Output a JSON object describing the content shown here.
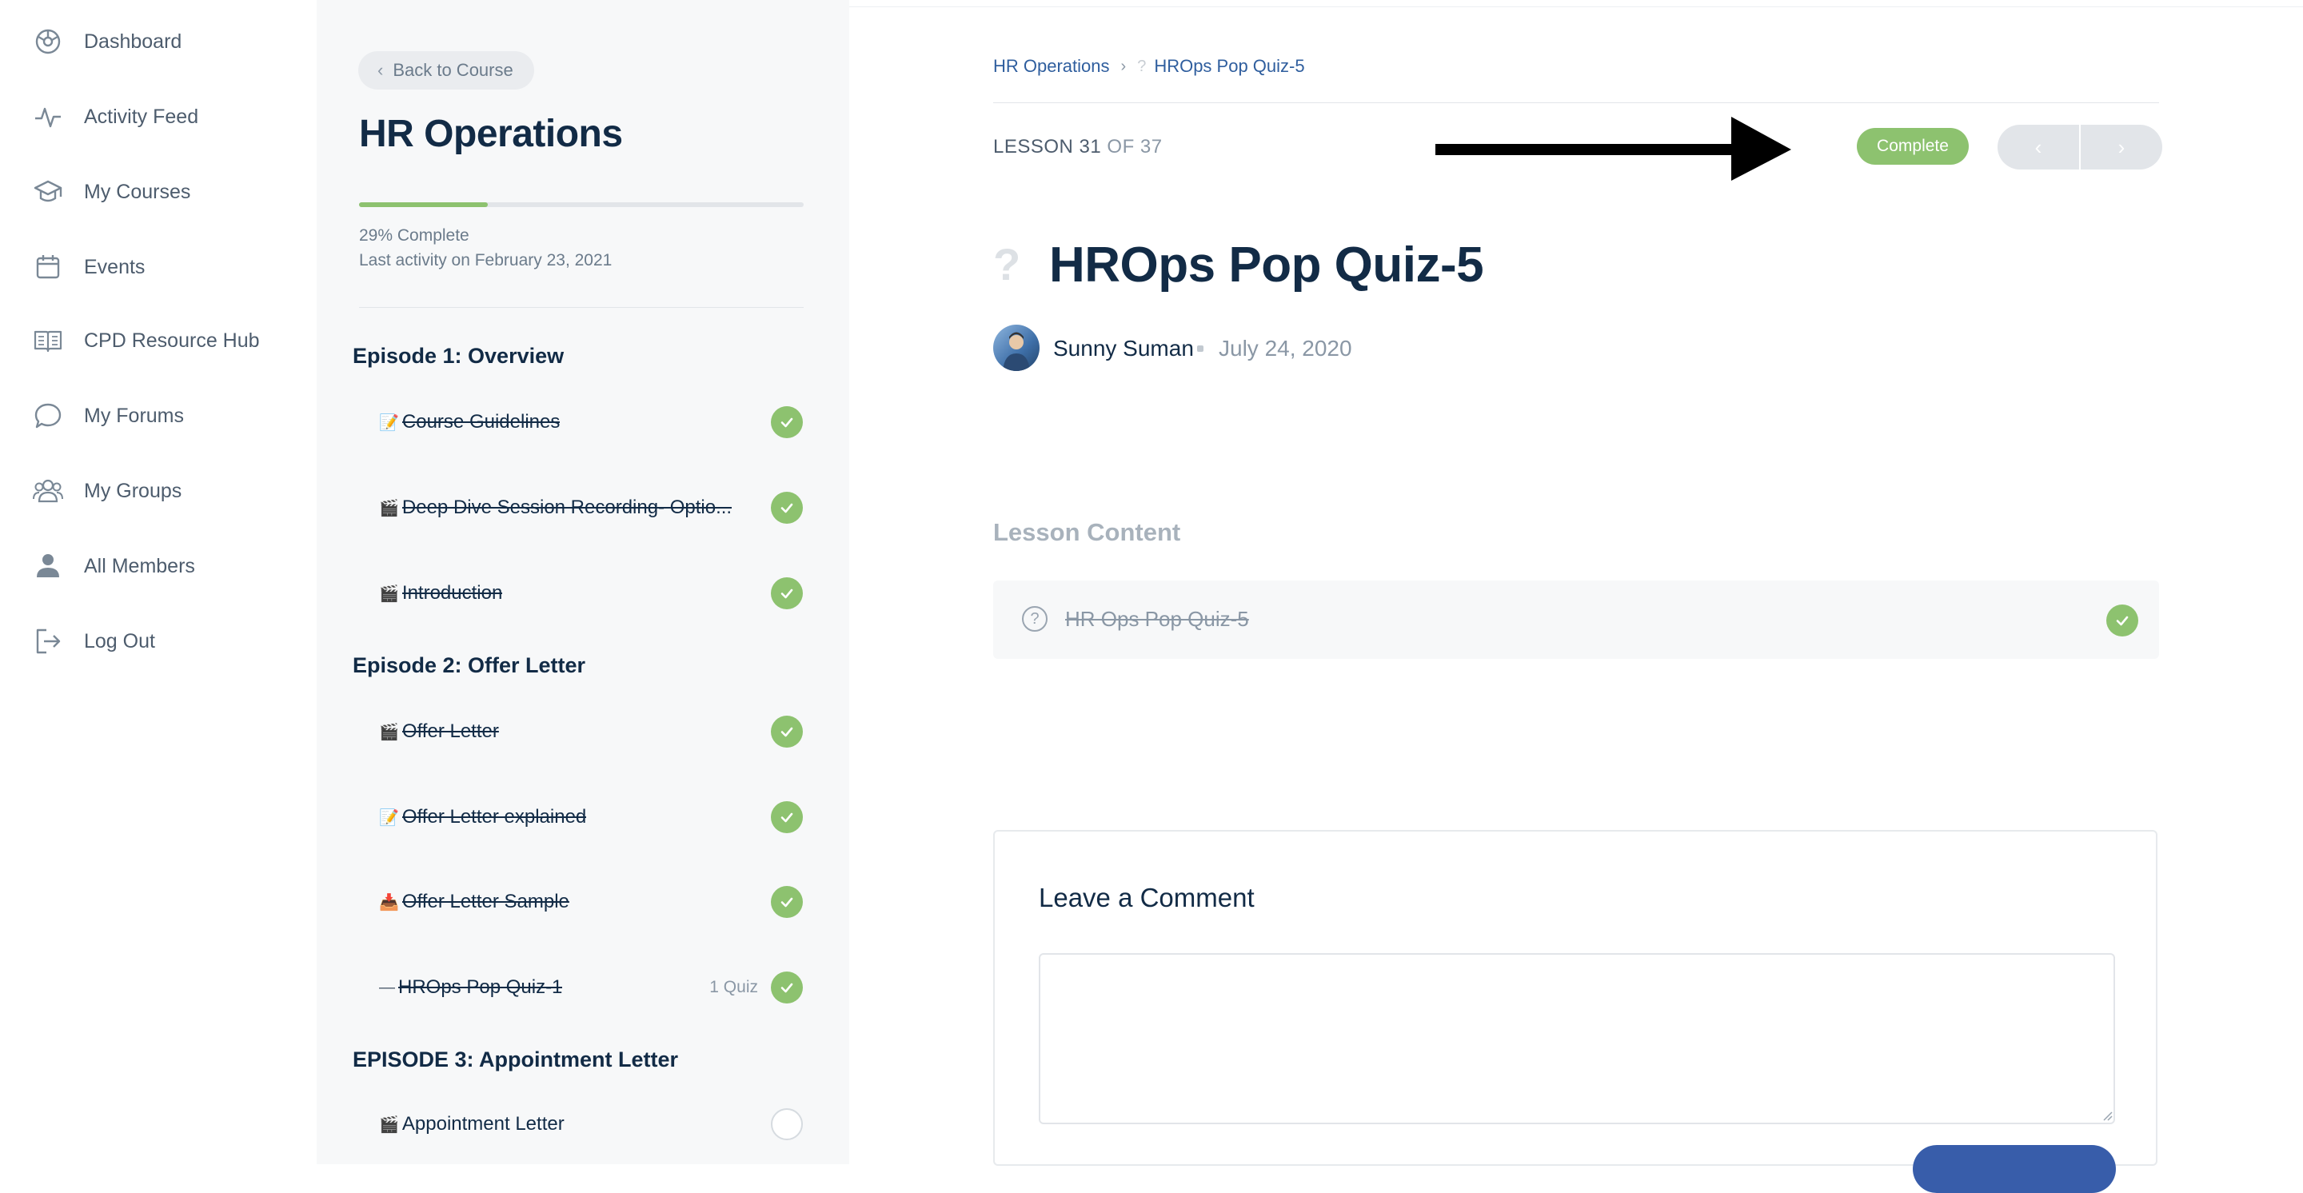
{
  "nav": {
    "items": [
      {
        "label": "Dashboard",
        "icon": "dashboard-icon"
      },
      {
        "label": "Activity Feed",
        "icon": "activity-icon"
      },
      {
        "label": "My Courses",
        "icon": "graduation-cap-icon"
      },
      {
        "label": "Events",
        "icon": "calendar-icon"
      },
      {
        "label": "CPD Resource Hub",
        "icon": "book-icon"
      },
      {
        "label": "My Forums",
        "icon": "chat-bubble-icon"
      },
      {
        "label": "My Groups",
        "icon": "group-icon"
      },
      {
        "label": "All Members",
        "icon": "person-icon"
      },
      {
        "label": "Log Out",
        "icon": "logout-icon"
      }
    ]
  },
  "course": {
    "back_label": "Back to Course",
    "title": "HR Operations",
    "progress_percent": 29,
    "progress_text": "29% Complete",
    "last_activity": "Last activity on February 23, 2021",
    "episodes": [
      {
        "title": "Episode 1: Overview",
        "lessons": [
          {
            "icon": "📝",
            "title": "Course Guidelines",
            "done": true,
            "meta": ""
          },
          {
            "icon": "🎬",
            "title": "Deep Dive Session Recording- Optio...",
            "done": true,
            "meta": ""
          },
          {
            "icon": "🎬",
            "title": "Introduction",
            "done": true,
            "meta": ""
          }
        ]
      },
      {
        "title": "Episode 2: Offer Letter",
        "lessons": [
          {
            "icon": "🎬",
            "title": "Offer Letter",
            "done": true,
            "meta": ""
          },
          {
            "icon": "📝",
            "title": "Offer Letter explained",
            "done": true,
            "meta": ""
          },
          {
            "icon": "📥",
            "title": "Offer Letter Sample",
            "done": true,
            "meta": ""
          },
          {
            "icon": "—",
            "title": "HROps Pop Quiz-1",
            "done": true,
            "meta": "1 Quiz"
          }
        ]
      },
      {
        "title": "EPISODE 3: Appointment Letter",
        "lessons": [
          {
            "icon": "🎬",
            "title": "Appointment Letter",
            "done": false,
            "meta": ""
          }
        ]
      }
    ]
  },
  "main": {
    "breadcrumb": {
      "course": "HR Operations",
      "current": "HROps Pop Quiz-5"
    },
    "lesson_label": "LESSON 31",
    "lesson_of": "OF 37",
    "status": "Complete",
    "prev_icon": "chevron-left-icon",
    "next_icon": "chevron-right-icon",
    "title": "HROps Pop Quiz-5",
    "author": "Sunny Suman",
    "date": "July 24, 2020",
    "lesson_content_heading": "Lesson Content",
    "content_item": "HR Ops Pop Quiz-5",
    "comment_heading": "Leave a Comment",
    "comment_value": ""
  },
  "colors": {
    "complete_green": "#8dc26f",
    "heading_navy": "#122b46",
    "link_blue": "#2f5e9e",
    "button_blue": "#385daa"
  }
}
